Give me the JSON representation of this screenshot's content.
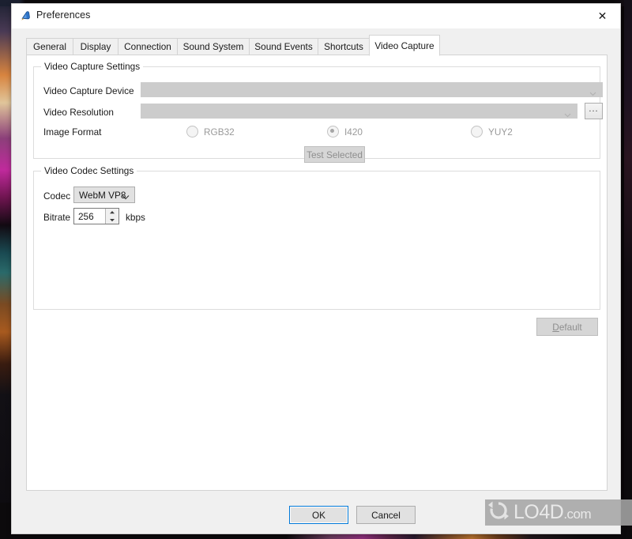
{
  "window": {
    "title": "Preferences",
    "icon": "app-shield-icon",
    "close_label": "✕"
  },
  "tabs": [
    {
      "label": "General",
      "active": false
    },
    {
      "label": "Display",
      "active": false
    },
    {
      "label": "Connection",
      "active": false
    },
    {
      "label": "Sound System",
      "active": false
    },
    {
      "label": "Sound Events",
      "active": false
    },
    {
      "label": "Shortcuts",
      "active": false
    },
    {
      "label": "Video Capture",
      "active": true
    }
  ],
  "capture_settings": {
    "legend": "Video Capture Settings",
    "device_label": "Video Capture Device",
    "device_value": "",
    "resolution_label": "Video Resolution",
    "resolution_value": "",
    "browse_label": "...",
    "image_format_label": "Image Format",
    "image_formats": [
      {
        "label": "RGB32",
        "selected": false
      },
      {
        "label": "I420",
        "selected": true
      },
      {
        "label": "YUY2",
        "selected": false
      }
    ],
    "test_button": "Test Selected"
  },
  "codec_settings": {
    "legend": "Video Codec Settings",
    "codec_label": "Codec",
    "codec_value": "WebM VP8",
    "bitrate_label": "Bitrate",
    "bitrate_value": "256",
    "bitrate_units": "kbps"
  },
  "default_button": {
    "label": "Default",
    "accel": "D"
  },
  "footer": {
    "ok_label": "OK",
    "cancel_label": "Cancel"
  },
  "watermark": {
    "name": "LO4D",
    "suffix": ".com"
  },
  "colors": {
    "accent": "#0078d7",
    "window_bg": "#f0f0f0",
    "page_bg": "#ffffff",
    "disabled_field": "#cccccc",
    "disabled_text": "#9a9a9a"
  }
}
